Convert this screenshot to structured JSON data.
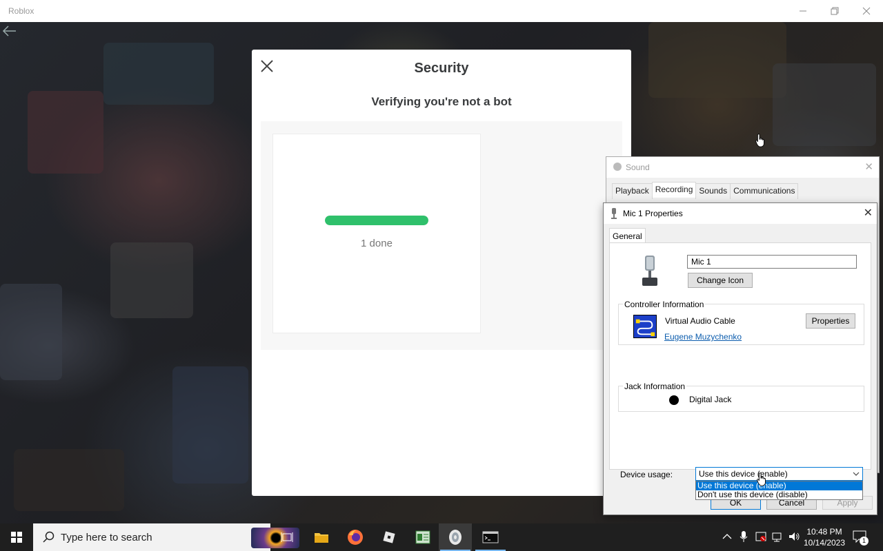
{
  "roblox": {
    "window_title": "Roblox"
  },
  "security_dialog": {
    "title": "Security",
    "subtitle": "Verifying you're not a bot",
    "progress_fraction": 1.0,
    "progress_text": "1 done"
  },
  "sound_window": {
    "title": "Sound",
    "tabs": [
      "Playback",
      "Recording",
      "Sounds",
      "Communications"
    ],
    "active_tab": "Recording"
  },
  "mic_properties": {
    "title": "Mic 1 Properties",
    "tab": "General",
    "device_name": "Mic 1",
    "change_icon_label": "Change Icon",
    "controller_group": "Controller Information",
    "controller_name": "Virtual Audio Cable",
    "controller_properties_label": "Properties",
    "controller_vendor_link": "Eugene Muzychenko",
    "jack_group": "Jack Information",
    "jack_name": "Digital Jack",
    "device_usage_label": "Device usage:",
    "device_usage_value": "Use this device (enable)",
    "device_usage_options": [
      "Use this device (enable)",
      "Don't use this device (disable)"
    ],
    "ok_label": "OK",
    "cancel_label": "Cancel",
    "apply_label": "Apply"
  },
  "taskbar": {
    "search_placeholder": "Type here to search",
    "time": "10:48 PM",
    "date": "10/14/2023",
    "notification_count": "1",
    "apps": [
      "task-view-icon",
      "file-explorer-icon",
      "firefox-icon",
      "roblox-icon",
      "spreadsheet-icon",
      "roblox-player-icon",
      "terminal-icon"
    ]
  },
  "colors": {
    "progress_green": "#2fc06b",
    "accent_blue": "#0078d7",
    "taskbar_bg": "#1f1f1f"
  }
}
